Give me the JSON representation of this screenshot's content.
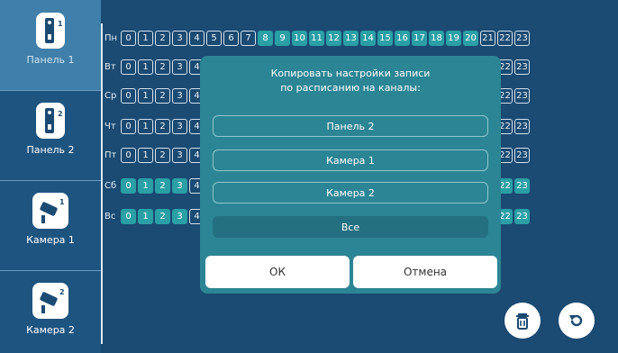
{
  "sidebar": {
    "items": [
      {
        "label": "Панель 1",
        "icon": "panel-icon",
        "badge": "1",
        "active": true
      },
      {
        "label": "Панель 2",
        "icon": "panel-icon",
        "badge": "2",
        "active": false
      },
      {
        "label": "Камера 1",
        "icon": "camera-icon",
        "badge": "1",
        "active": false
      },
      {
        "label": "Камера 2",
        "icon": "camera-icon",
        "badge": "2",
        "active": false
      }
    ]
  },
  "schedule": {
    "days": [
      "Пн",
      "Вт",
      "Ср",
      "Чт",
      "Пт",
      "Сб",
      "Вс"
    ],
    "hours": [
      "0",
      "1",
      "2",
      "3",
      "4",
      "5",
      "6",
      "7",
      "8",
      "9",
      "10",
      "11",
      "12",
      "13",
      "14",
      "15",
      "16",
      "17",
      "18",
      "19",
      "20",
      "21",
      "22",
      "23"
    ],
    "selected_hours_monday": [
      "8",
      "9",
      "10",
      "11",
      "12",
      "13",
      "14",
      "15",
      "16",
      "17",
      "18",
      "19",
      "20"
    ],
    "selected_hours_weekend": [
      "0",
      "1",
      "2",
      "3",
      "18",
      "19",
      "20",
      "21",
      "22",
      "23"
    ]
  },
  "dialog": {
    "title": "Копировать настройки записи\nпо расписанию на каналы:",
    "options": [
      {
        "label": "Панель 2",
        "filled": false
      },
      {
        "label": "Камера 1",
        "filled": false
      },
      {
        "label": "Камера 2",
        "filled": false
      },
      {
        "label": "Все",
        "filled": true
      }
    ],
    "ok_label": "ОК",
    "cancel_label": "Отмена"
  },
  "actions": {
    "delete_icon": "trash-icon",
    "reset_icon": "undo-icon"
  },
  "colors": {
    "background": "#1b4a72",
    "active_tab": "#3f7fa9",
    "accent": "#2a9fa6",
    "dialog": "#2c8594"
  }
}
